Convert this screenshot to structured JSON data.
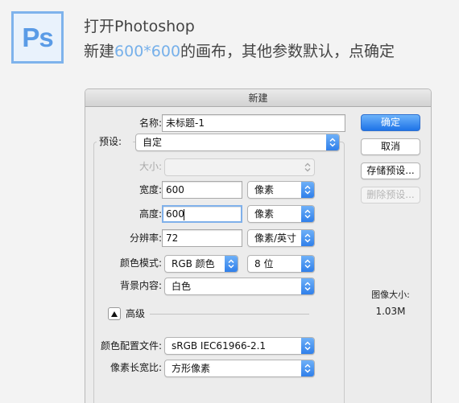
{
  "logo": {
    "text": "Ps",
    "icon": "photoshop-icon"
  },
  "intro": {
    "line1": "打开Photoshop",
    "line2_prefix": "新建",
    "line2_highlight": "600*600",
    "line2_suffix": "的画布，其他参数默认，点确定"
  },
  "dialog": {
    "title": "新建",
    "name_label": "名称:",
    "name_value": "未标题-1",
    "preset_label": "预设:",
    "preset_value": "自定",
    "size_label": "大小:",
    "size_value": "",
    "width_label": "宽度:",
    "width_value": "600",
    "width_unit": "像素",
    "height_label": "高度:",
    "height_value": "600",
    "height_unit": "像素",
    "resolution_label": "分辨率:",
    "resolution_value": "72",
    "resolution_unit": "像素/英寸",
    "color_mode_label": "颜色模式:",
    "color_mode_value": "RGB 颜色",
    "bit_depth_value": "8 位",
    "background_label": "背景内容:",
    "background_value": "白色",
    "advanced_label": "高级",
    "color_profile_label": "颜色配置文件:",
    "color_profile_value": "sRGB IEC61966-2.1",
    "pixel_aspect_label": "像素长宽比:",
    "pixel_aspect_value": "方形像素",
    "image_size_label": "图像大小:",
    "image_size_value": "1.03M"
  },
  "buttons": {
    "ok": "确定",
    "cancel": "取消",
    "save_preset": "存储预设...",
    "delete_preset": "删除预设..."
  },
  "colors": {
    "accent": "#76b0ea",
    "primary_button": "#1e73e8"
  }
}
